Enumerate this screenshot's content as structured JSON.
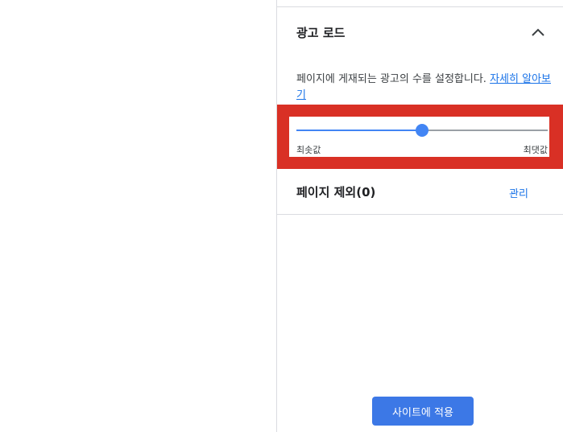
{
  "ad_load": {
    "title": "광고 로드",
    "expanded": true,
    "description": "페이지에 게재되는 광고의 수를 설정합니다.",
    "learn_more": "자세히 알아보기",
    "slider": {
      "min_label": "최솟값",
      "max_label": "최댓값",
      "value_fraction": 0.5
    }
  },
  "page_exclusions": {
    "title": "페이지 제외(0)",
    "manage_label": "관리"
  },
  "apply_button": {
    "label": "사이트에 적용"
  },
  "colors": {
    "accent": "#4285f4",
    "button": "#3c78e6",
    "link": "#1a73e8",
    "highlight": "#d93025"
  }
}
